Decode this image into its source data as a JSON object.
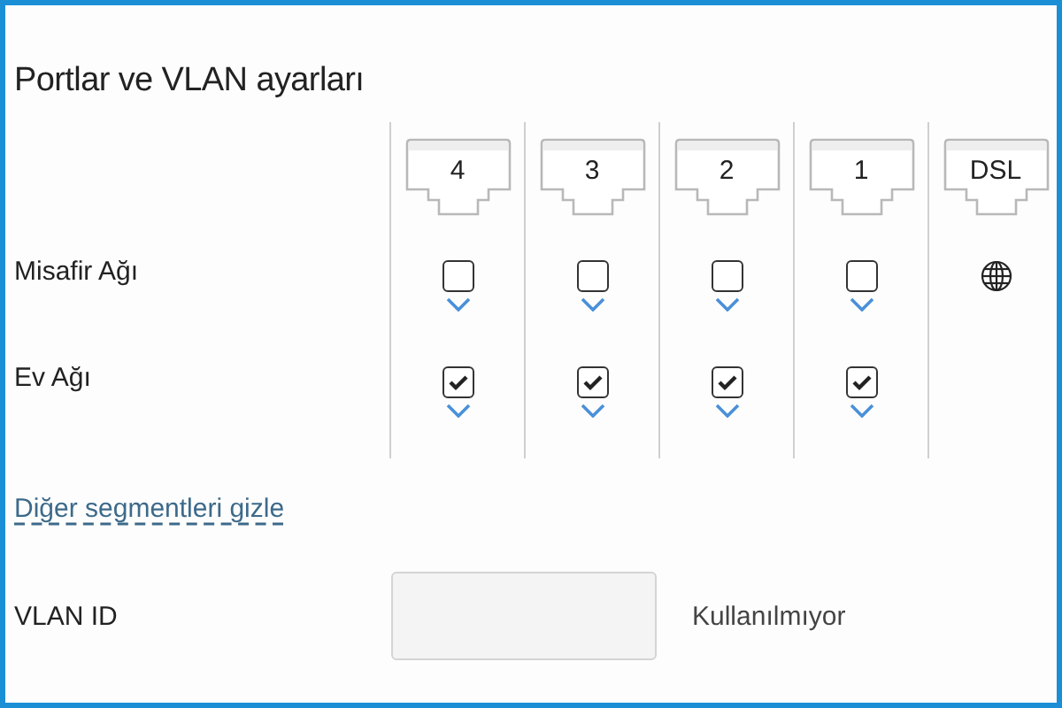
{
  "title": "Portlar ve VLAN ayarları",
  "ports": [
    {
      "label": "4"
    },
    {
      "label": "3"
    },
    {
      "label": "2"
    },
    {
      "label": "1"
    },
    {
      "label": "DSL"
    }
  ],
  "networks": [
    {
      "name": "Misafir Ağı",
      "cells": [
        {
          "kind": "checkbox",
          "checked": false
        },
        {
          "kind": "checkbox",
          "checked": false
        },
        {
          "kind": "checkbox",
          "checked": false
        },
        {
          "kind": "checkbox",
          "checked": false
        },
        {
          "kind": "globe"
        }
      ]
    },
    {
      "name": "Ev Ağı",
      "cells": [
        {
          "kind": "checkbox",
          "checked": true
        },
        {
          "kind": "checkbox",
          "checked": true
        },
        {
          "kind": "checkbox",
          "checked": true
        },
        {
          "kind": "checkbox",
          "checked": true
        }
      ]
    }
  ],
  "toggle_link": "Diğer segmentleri gizle",
  "vlan": {
    "label": "VLAN ID",
    "status": "Kullanılmıyor"
  }
}
